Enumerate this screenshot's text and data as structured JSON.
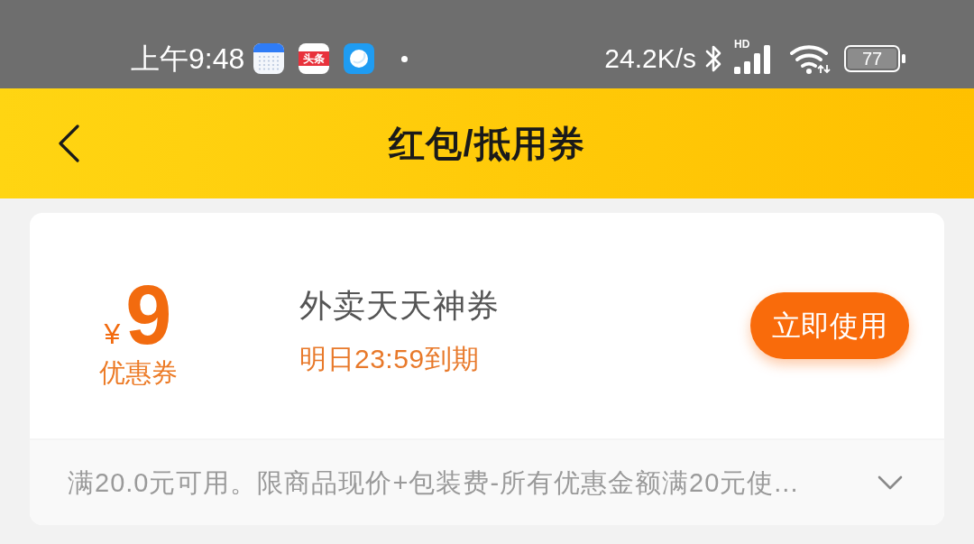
{
  "status_bar": {
    "time": "上午9:48",
    "notification_icons": [
      {
        "kind": "calendar"
      },
      {
        "kind": "news",
        "label": "头条"
      },
      {
        "kind": "chat"
      },
      {
        "kind": "dot"
      }
    ],
    "network_speed": "24.2K/s",
    "signal_label": "HD",
    "battery": "77"
  },
  "header": {
    "title": "红包/抵用券"
  },
  "coupons": [
    {
      "currency": "¥",
      "amount": "9",
      "type_label": "优惠券",
      "name": "外卖天天神券",
      "expiry": "明日23:59到期",
      "button": "立即使用",
      "terms": "满20.0元可用。限商品现价+包装费-所有优惠金额满20元使...",
      "expanded": false
    }
  ]
}
